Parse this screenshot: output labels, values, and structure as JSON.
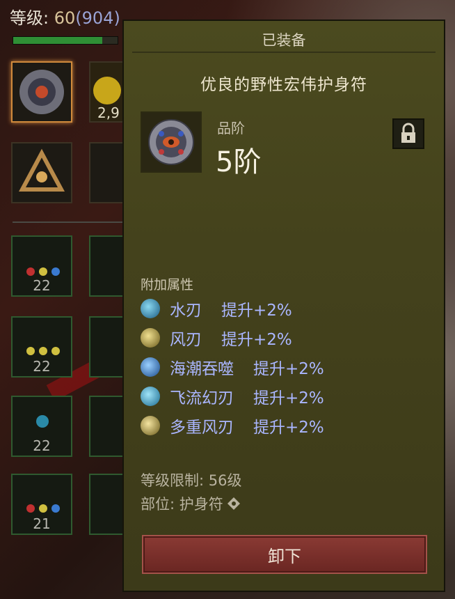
{
  "character": {
    "level_label": "等级:",
    "level": "60",
    "paragon": "(904)",
    "xp_fraction": 0.85
  },
  "sidebar": {
    "currency_text": "2,9",
    "slots": [
      {
        "name": "amulet-slot",
        "level": ""
      },
      {
        "name": "charm-slot",
        "level": ""
      },
      {
        "name": "ring-slot-1",
        "level": "22"
      },
      {
        "name": "ring-slot-2",
        "level": "22"
      },
      {
        "name": "ring-slot-3",
        "level": "22"
      },
      {
        "name": "ring-slot-4",
        "level": "21"
      }
    ]
  },
  "tooltip": {
    "header": "已装备",
    "item_name": "优良的野性宏伟护身符",
    "tier_label": "品阶",
    "tier_value": "5阶",
    "attr_title": "附加属性",
    "attributes": [
      {
        "name": "水刃",
        "bonus": "提升+2%",
        "orb_color": "#2f8fb8"
      },
      {
        "name": "风刃",
        "bonus": "提升+2%",
        "orb_color": "#b8a24a"
      },
      {
        "name": "海潮吞噬",
        "bonus": "提升+2%",
        "orb_color": "#3a8fd0"
      },
      {
        "name": "飞流幻刃",
        "bonus": "提升+2%",
        "orb_color": "#2f9ac8"
      },
      {
        "name": "多重风刃",
        "bonus": "提升+2%",
        "orb_color": "#b8a24a"
      }
    ],
    "level_req": "等级限制: 56级",
    "slot_type": "部位: 护身符",
    "unequip_label": "卸下"
  },
  "colors": {
    "panel_bg": "#4b4a1f",
    "attr_text": "#aab6ff",
    "button_red": "#8a3a34"
  }
}
